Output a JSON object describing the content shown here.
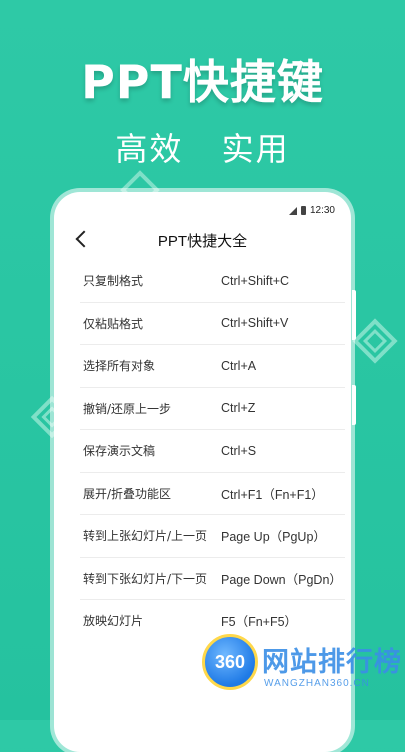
{
  "hero": {
    "title": "PPT快捷键",
    "subtitle": "高效 实用"
  },
  "status_bar": {
    "time": "12:30",
    "icons": [
      "signal-icon",
      "battery-icon"
    ]
  },
  "header": {
    "back_icon": "chevron-left-icon",
    "title": "PPT快捷大全"
  },
  "shortcuts": [
    {
      "name": "只复制格式",
      "keys": "Ctrl+Shift+C"
    },
    {
      "name": "仅粘贴格式",
      "keys": "Ctrl+Shift+V"
    },
    {
      "name": "选择所有对象",
      "keys": "Ctrl+A"
    },
    {
      "name": "撤销/还原上一步",
      "keys": "Ctrl+Z"
    },
    {
      "name": "保存演示文稿",
      "keys": "Ctrl+S"
    },
    {
      "name": "展开/折叠功能区",
      "keys": "Ctrl+F1（Fn+F1）"
    },
    {
      "name": "转到上张幻灯片/上一页",
      "keys": "Page Up（PgUp）"
    },
    {
      "name": "转到下张幻灯片/下一页",
      "keys": "Page Down（PgDn）"
    },
    {
      "name": "放映幻灯片",
      "keys": "F5（Fn+F5）"
    }
  ],
  "watermark": {
    "logo_text": "360",
    "name": "网站排行榜",
    "url": "WANGZHAN360.CN"
  },
  "colors": {
    "background": "#27c5a2",
    "card": "#ffffff",
    "text": "#333333",
    "watermark": "#3a8ee6"
  }
}
